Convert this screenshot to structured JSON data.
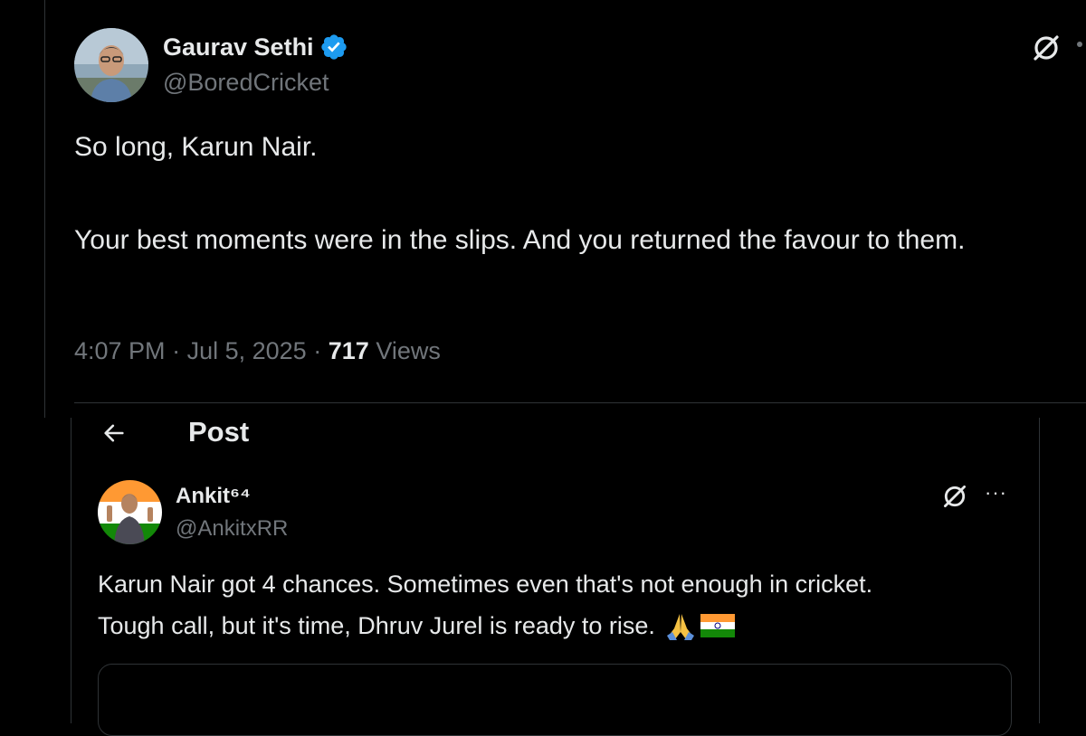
{
  "tweet1": {
    "author_name": "Gaurav Sethi",
    "author_handle": "@BoredCricket",
    "line1": "So long, Karun Nair.",
    "line2": "Your best moments were in the slips. And you returned the favour to them.",
    "time": "4:07 PM",
    "date": "Jul 5, 2025",
    "views_count": "717",
    "views_label": "Views",
    "sep": "·"
  },
  "header": {
    "back_icon": "arrow-left-icon",
    "title": "Post"
  },
  "tweet2": {
    "author_name": "Ankit⁶⁴",
    "author_handle": "@AnkitxRR",
    "line1": "Karun Nair got 4 chances. Sometimes even that's not enough in cricket.",
    "line2": "Tough call, but it's time, Dhruv Jurel is ready to rise.",
    "more_label": "···"
  },
  "colors": {
    "background": "#000000",
    "text": "#e7e9ea",
    "muted": "#71767b",
    "verified": "#1d9bf0",
    "border": "#2f3336"
  }
}
